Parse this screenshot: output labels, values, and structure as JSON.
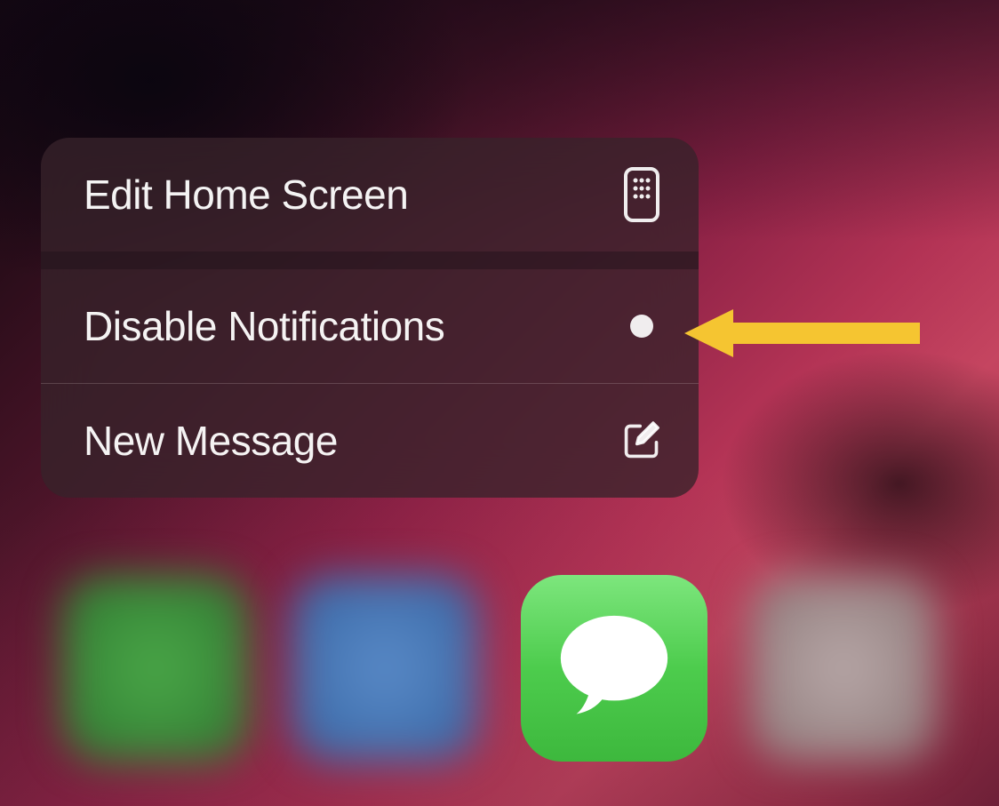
{
  "menu": {
    "items": [
      {
        "label": "Edit Home Screen",
        "icon": "phone-apps-icon"
      },
      {
        "label": "Disable Notifications",
        "icon": "dot-icon"
      },
      {
        "label": "New Message",
        "icon": "compose-icon"
      }
    ]
  },
  "annotation": {
    "arrow_target": "Disable Notifications"
  },
  "dock": {
    "active_app": "Messages"
  }
}
